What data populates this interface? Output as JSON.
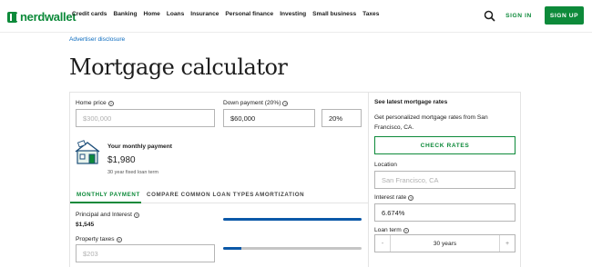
{
  "brand": {
    "name": "nerdwallet",
    "color": "#0d8a3a"
  },
  "nav": {
    "items": [
      "Credit cards",
      "Banking",
      "Home",
      "Loans",
      "Insurance",
      "Personal finance",
      "Investing",
      "Small business",
      "Taxes"
    ],
    "search_icon": "search-icon",
    "sign_in": "SIGN IN",
    "sign_up": "SIGN UP"
  },
  "advertiser_disclosure": "Advertiser disclosure",
  "page_title": "Mortgage calculator",
  "calculator": {
    "home_price": {
      "label": "Home price",
      "placeholder": "$300,000"
    },
    "down_payment": {
      "label": "Down payment (20%)",
      "amount": "$60,000",
      "percent": "20%"
    },
    "monthly_payment": {
      "label": "Your monthly payment",
      "value": "$1,980",
      "sub": "30 year fixed loan term"
    },
    "tabs": [
      "MONTHLY PAYMENT",
      "COMPARE COMMON LOAN TYPES",
      "AMORTIZATION"
    ],
    "principal_interest": {
      "label": "Principal and Interest",
      "value": "$1,545",
      "bar_fraction": 1.0
    },
    "property_taxes": {
      "label": "Property taxes",
      "placeholder": "$203",
      "bar_fraction": 0.13
    }
  },
  "rates": {
    "title": "See latest mortgage rates",
    "text": "Get personalized mortgage rates from San Francisco, CA.",
    "check_button": "CHECK RATES",
    "location": {
      "label": "Location",
      "placeholder": "San Francisco, CA"
    },
    "interest_rate": {
      "label": "Interest rate",
      "value": "6.674%"
    },
    "loan_term": {
      "label": "Loan term",
      "value": "30 years",
      "minus": "-",
      "plus": "+"
    }
  },
  "colors": {
    "accent": "#0d8a3a",
    "link": "#0b6bbf",
    "bar": "#0b58a8"
  }
}
